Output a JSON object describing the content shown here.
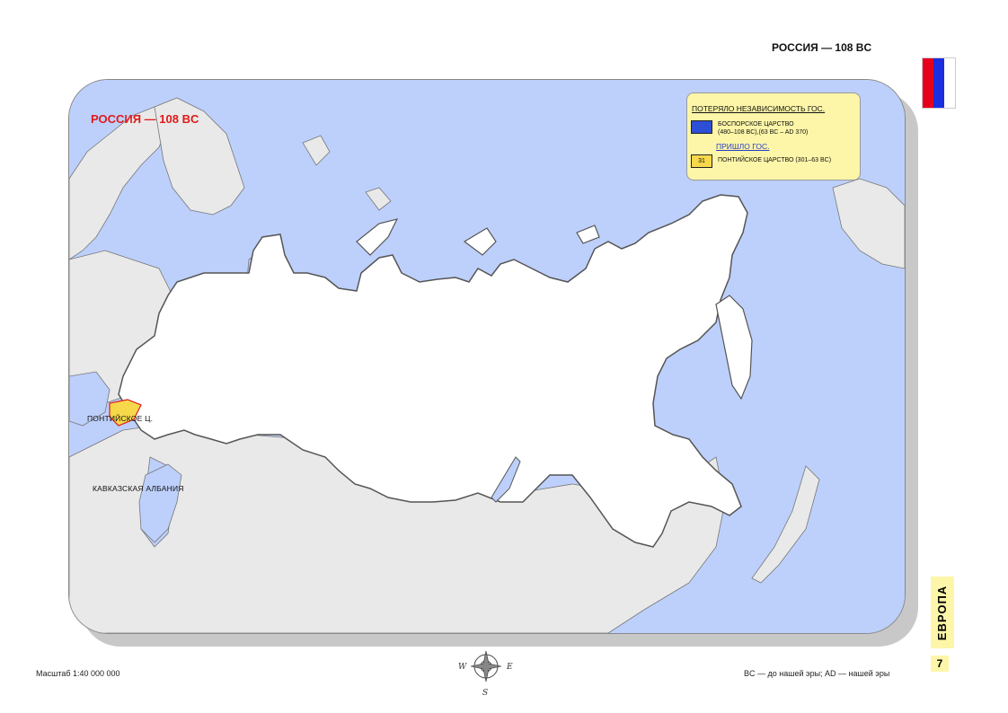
{
  "header": {
    "title": "РОССИЯ — 108 BC"
  },
  "colors": {
    "flag_top": "#e5001c",
    "flag_mid": "#1a2ee0",
    "flag_bottom": "#ffffff",
    "sea": "#bdd0fb",
    "land_other": "#e9e9e9",
    "land_focus": "#ffffff",
    "border": "#777777",
    "map_title": "#e01a1a",
    "legend_bg": "#fdf6a8",
    "legend_swatch_blue": "#2d4fd6",
    "legend_swatch_yellow": "#f6d84a"
  },
  "map": {
    "title": "РОССИЯ — 108 BC",
    "labels": {
      "pontic": "ПОНТИЙСКОЕ Ц.",
      "albania": "КАВКАЗСКАЯ АЛБАНИЯ"
    }
  },
  "legend": {
    "lost_heading": "ПОТЕРЯЛО НЕЗАВИСИМОСТЬ ГОС.",
    "lost_items": [
      {
        "code": "",
        "name": "БОСПОРСКОЕ ЦАРСТВО",
        "dates": "(480–108 BC),(63 BC – AD 370)"
      }
    ],
    "gained_heading": "ПРИШЛО ГОС.",
    "gained_items": [
      {
        "code": "31",
        "name": "ПОНТИЙСКОЕ ЦАРСТВО (301–63 BC)"
      }
    ]
  },
  "footer": {
    "scale": "Масштаб 1:40 000 000",
    "note": "BC — до нашей эры; AD — нашей эры"
  },
  "compass": {
    "letters": [
      "W",
      "E",
      "S"
    ]
  },
  "side": {
    "section": "ЕВРОПА",
    "page": "7"
  }
}
